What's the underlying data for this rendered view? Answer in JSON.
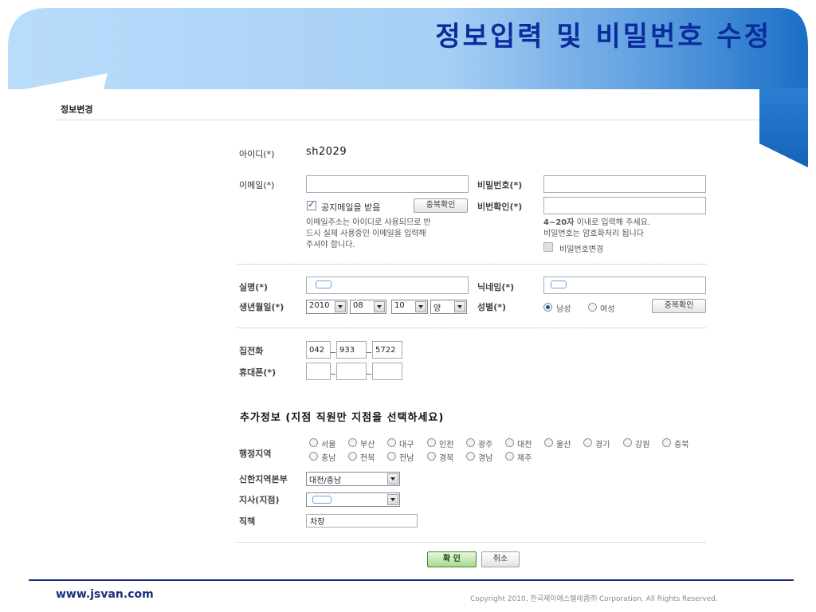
{
  "slide": {
    "title": "정보입력 및 비밀번호 수정",
    "footer_url": "www.jsvan.com",
    "footer_copyright": "Copyright 2010, 한국제이에스텔레콤㈜ Corporation. All Rights Reserved."
  },
  "panel": {
    "title": "정보변경"
  },
  "form": {
    "id_label": "아이디(*)",
    "id_value": "sh2029",
    "email_label": "이메일(*)",
    "email_value": "",
    "receive_notice_label": "공지메일을 받음",
    "email_dup_check_button": "중복확인",
    "email_note_1": "이메일주소는 아이디로 사용되므로 반",
    "email_note_2": "드시 실제 사용중인 이메일을 입력해",
    "email_note_3": "주셔야 합니다.",
    "password_label": "비밀번호(*)",
    "password_confirm_label": "비번확인(*)",
    "password_note_1_bold": "4~20자",
    "password_note_1_rest": " 이내로 입력해 주세요.",
    "password_note_2": "비밀번호는 암호화처리 됩니다",
    "change_password_label": "비밀번호변경",
    "name_label": "실명(*)",
    "nickname_label": "닉네임(*)",
    "birth_label": "생년월일(*)",
    "birth_year": "2010",
    "birth_month": "08",
    "birth_day": "10",
    "birth_calendar": "양",
    "gender_label": "성별(*)",
    "gender_male": "남성",
    "gender_female": "여성",
    "gender_selected": "남성",
    "nickname_dup_check_button": "중복확인",
    "home_phone_label": "집전화",
    "home_phone_1": "042",
    "home_phone_2": "933",
    "home_phone_3": "5722",
    "mobile_label": "휴대폰(*)",
    "mobile_1": "",
    "mobile_2": "",
    "mobile_3": ""
  },
  "extra": {
    "section_title": "추가정보 (지점 직원만 지점을 선택하세요)",
    "region_label": "행정지역",
    "regions_row1": [
      "서울",
      "부산",
      "대구",
      "인천",
      "광주",
      "대전",
      "울산",
      "경기",
      "강원",
      "충북"
    ],
    "regions_row2": [
      "충남",
      "전북",
      "전남",
      "경북",
      "경남",
      "제주"
    ],
    "hq_label": "신한지역본부",
    "hq_value": "대전/충남",
    "branch_label": "지사(지점)",
    "branch_value": "",
    "position_label": "직책",
    "position_value": "차장"
  },
  "actions": {
    "confirm": "확 인",
    "cancel": "취소"
  },
  "colors": {
    "title": "#0a2c9c",
    "banner_light": "#a9d0f5",
    "banner_dark": "#1d73c9",
    "confirm_button": "#a9d98e"
  }
}
